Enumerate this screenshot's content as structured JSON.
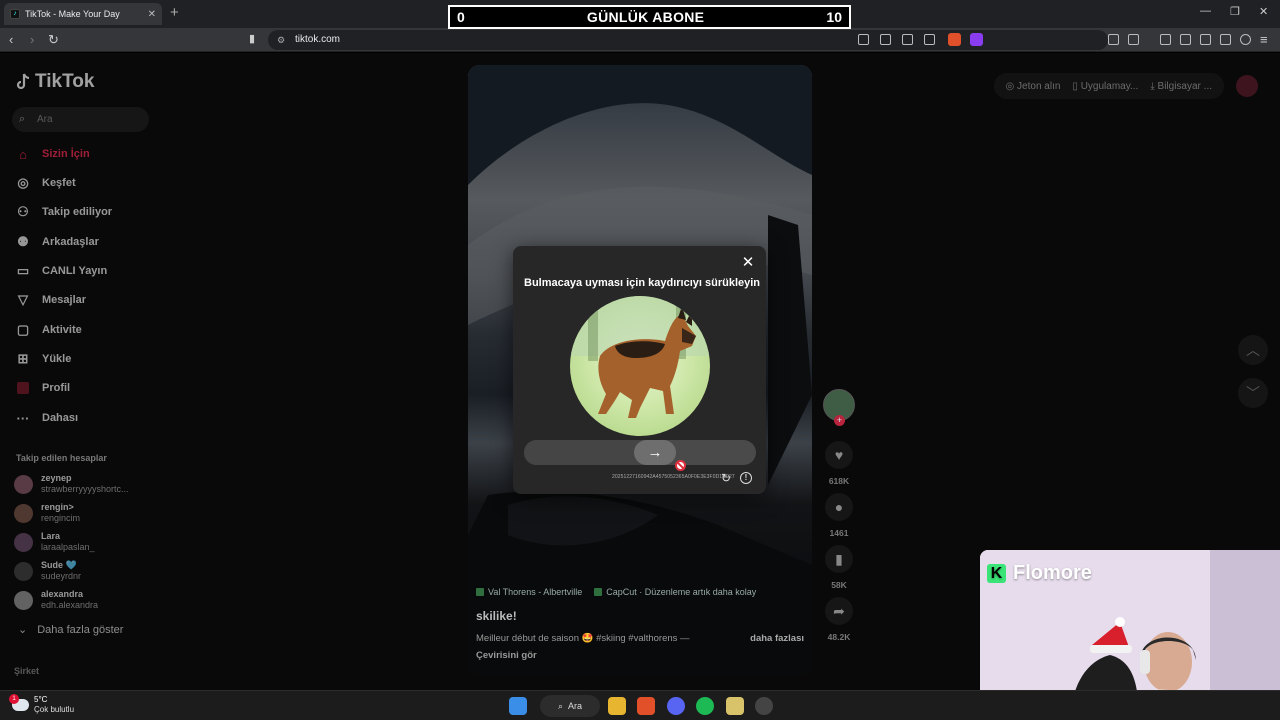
{
  "browser": {
    "tab_title": "TikTok - Make Your Day",
    "url": "tiktok.com"
  },
  "overlay": {
    "left_count": "0",
    "label": "GÜNLÜK ABONE",
    "right_count": "10"
  },
  "sidebar": {
    "logo": "TikTok",
    "search_placeholder": "Ara",
    "nav": [
      {
        "label": "Sizin İçin",
        "icon": "home-icon",
        "active": true
      },
      {
        "label": "Keşfet",
        "icon": "compass-icon"
      },
      {
        "label": "Takip ediliyor",
        "icon": "user-follow-icon"
      },
      {
        "label": "Arkadaşlar",
        "icon": "friends-icon"
      },
      {
        "label": "CANLI Yayın",
        "icon": "live-icon"
      },
      {
        "label": "Mesajlar",
        "icon": "message-icon"
      },
      {
        "label": "Aktivite",
        "icon": "activity-icon"
      },
      {
        "label": "Yükle",
        "icon": "upload-icon"
      },
      {
        "label": "Profil",
        "icon": "profile-icon"
      },
      {
        "label": "Dahası",
        "icon": "more-icon"
      }
    ],
    "following_title": "Takip edilen hesaplar",
    "following": [
      {
        "name": "zeynep",
        "handle": "strawberryyyyshortc..."
      },
      {
        "name": "rengin>",
        "handle": "rengincim"
      },
      {
        "name": "Lara",
        "handle": "laraalpaslan_"
      },
      {
        "name": "Sude 🩵",
        "handle": "sudeyrdnr"
      },
      {
        "name": "alexandra",
        "handle": "edh.alexandra"
      }
    ],
    "show_more": "Daha fazla göster",
    "company": "Şirket"
  },
  "header_right": {
    "coins": "Jeton alın",
    "app": "Uygulamay...",
    "desktop": "Bilgisayar ..."
  },
  "video": {
    "location": "Val Thorens - Albertville",
    "capcut": "CapCut · Düzenleme artık daha kolay",
    "username": "skilike!",
    "description": "Meilleur début de saison 🤩 #skiing #valthorens —",
    "more": "daha fazlası",
    "translate": "Çevirisini gör"
  },
  "actions": {
    "likes": "618K",
    "comments": "1461",
    "saves": "58K",
    "shares": "48.2K"
  },
  "captcha": {
    "title": "Bulmacaya uyması için kaydırıcıyı sürükleyin",
    "id": "20251227160942A4575052365A0F0E3E3F0D1EE27",
    "slider_position": 0.58
  },
  "webcam": {
    "brand": "Flomore"
  },
  "taskbar": {
    "temp": "5°C",
    "weather": "Çok bulutlu",
    "weather_badge": "1",
    "search": "Ara"
  }
}
